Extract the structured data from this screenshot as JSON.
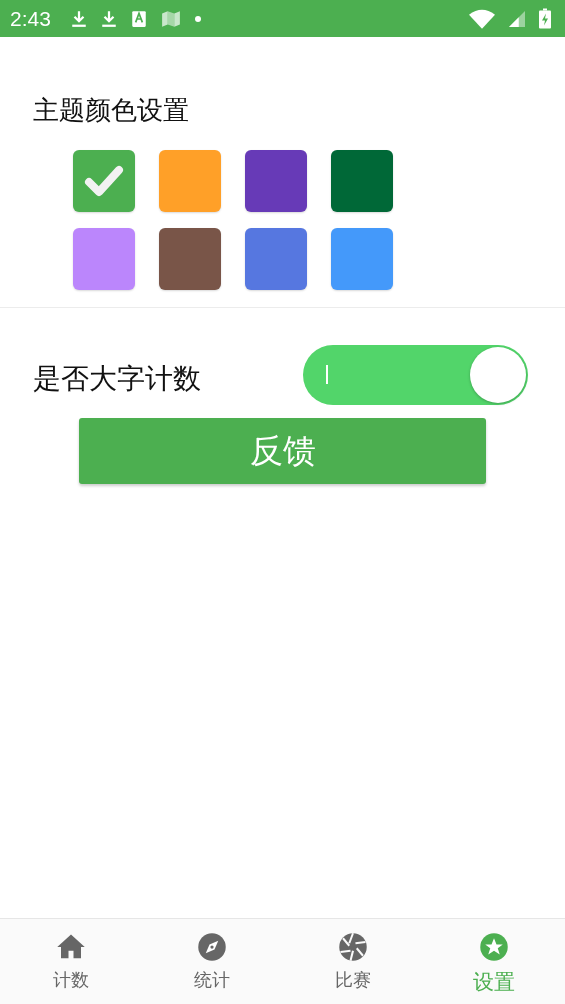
{
  "status_bar": {
    "time": "2:43"
  },
  "theme_section": {
    "title": "主题颜色设置",
    "swatches": [
      {
        "color": "#4caf50",
        "selected": true
      },
      {
        "color": "#ffa028",
        "selected": false
      },
      {
        "color": "#673ab7",
        "selected": false
      },
      {
        "color": "#006837",
        "selected": false
      },
      {
        "color": "#bb86fc",
        "selected": false
      },
      {
        "color": "#795548",
        "selected": false
      },
      {
        "color": "#5677e0",
        "selected": false
      },
      {
        "color": "#4499fa",
        "selected": false
      }
    ]
  },
  "large_count": {
    "label": "是否大字计数",
    "on": true
  },
  "feedback_button": {
    "label": "反馈"
  },
  "bottom_nav": [
    {
      "label": "计数",
      "kind": "home",
      "selected": false
    },
    {
      "label": "统计",
      "kind": "compass",
      "selected": false
    },
    {
      "label": "比赛",
      "kind": "aperture",
      "selected": false
    },
    {
      "label": "设置",
      "kind": "star",
      "selected": true
    }
  ]
}
